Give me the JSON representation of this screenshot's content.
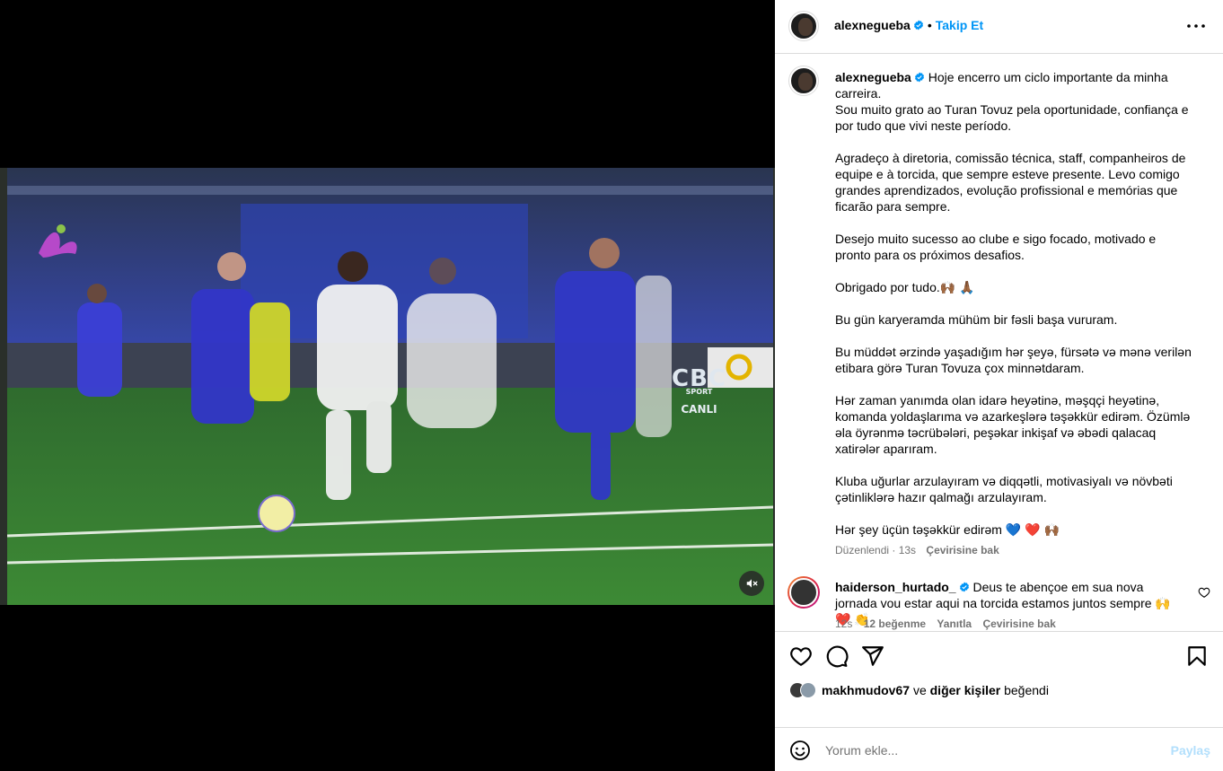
{
  "header": {
    "username": "alexnegueba",
    "separator": "•",
    "follow_label": "Takip Et"
  },
  "video": {
    "watermark_brand": "CBC",
    "watermark_sub": "SPORT",
    "watermark_live": "CANLI"
  },
  "caption": {
    "username": "alexnegueba",
    "lines": [
      "Hoje encerro um ciclo importante da minha carreira.",
      "Sou muito grato ao Turan Tovuz pela oportunidade, confiança e por tudo que vivi neste período.",
      "",
      "Agradeço à diretoria, comissão técnica, staff, companheiros de equipe e à torcida, que sempre esteve presente. Levo comigo grandes aprendizados, evolução profissional e memórias que ficarão para sempre.",
      "",
      "Desejo muito sucesso ao clube e sigo focado, motivado e pronto para os próximos desafios.",
      "",
      "Obrigado por tudo.🙌🏾 🙏🏾",
      "",
      "Bu gün karyeramda mühüm bir fəsli başa vururam.",
      "",
      "Bu müddət ərzində yaşadığım hər şeyə, fürsətə və mənə verilən etibara görə Turan Tovuza çox minnətdaram.",
      "",
      "Hər zaman yanımda olan idarə heyətinə, məşqçi heyətinə, komanda yoldaşlarıma və azarkeşlərə təşəkkür edirəm. Özümlə əla öyrənmə təcrübələri, peşəkar inkişaf və əbədi qalacaq xatirələr aparıram.",
      "",
      "Kluba uğurlar arzulayıram və diqqətli, motivasiyalı və növbəti çətinliklərə hazır qalmağı arzulayıram.",
      "",
      "Hər şey üçün təşəkkür edirəm 💙 ❤️ 🙌🏾"
    ],
    "edited": "Düzenlendi · 13s",
    "see_translation": "Çevirisine bak"
  },
  "comment": {
    "username": "haiderson_hurtado_",
    "text": "Deus te abençoe em sua nova jornada vou estar aqui na torcida estamos juntos sempre 🙌 ❤️ 👏",
    "time": "12s",
    "likes": "12 beğenme",
    "reply": "Yanıtla",
    "see_translation": "Çevirisine bak"
  },
  "likes_line": {
    "user": "makhmudov67",
    "conj": "ve",
    "others": "diğer kişiler",
    "suffix": "beğendi"
  },
  "add_comment": {
    "placeholder": "Yorum ekle...",
    "post_label": "Paylaş"
  },
  "colors": {
    "accent": "#0095f6",
    "verified": "#0095f6",
    "muted": "#737373",
    "border": "#dbdbdb"
  }
}
